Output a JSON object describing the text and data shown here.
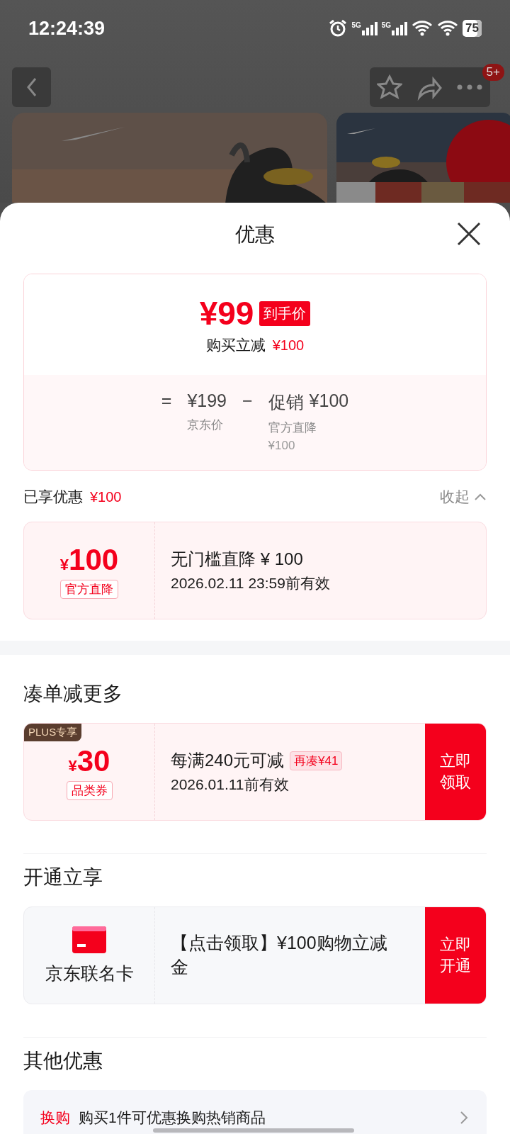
{
  "status_bar": {
    "time": "12:24:39",
    "networks": [
      "5G",
      "5G"
    ],
    "battery": "75"
  },
  "nav": {
    "badge": "5+"
  },
  "sheet": {
    "title": "优惠"
  },
  "price_card": {
    "final_price": "¥99",
    "price_tag": "到手价",
    "saving_label": "购买立减",
    "saving_amount": "¥100",
    "equals": "=",
    "list_price": "¥199",
    "list_price_label": "京东价",
    "minus": "−",
    "promo_label": "促销",
    "promo_amount": "¥100",
    "promo_sub": "官方直降",
    "promo_sub_amount": "¥100"
  },
  "enjoyed": {
    "label": "已享优惠",
    "amount": "¥100",
    "toggle": "收起",
    "expanded": true
  },
  "applied_coupons": [
    {
      "kind": "coupon",
      "currency": "¥",
      "amount": "100",
      "tag": "官方直降",
      "title": "无门槛直降 ¥ 100",
      "validity": "2026.02.11 23:59前有效"
    }
  ],
  "sections": [
    {
      "heading": "凑单减更多",
      "items": [
        {
          "kind": "coupon",
          "badge": "PLUS专享",
          "currency": "¥",
          "amount": "30",
          "tag": "品类券",
          "title": "每满240元可减",
          "extra": "再凑¥41",
          "validity": "2026.01.11前有效",
          "action": "立即领取"
        }
      ]
    },
    {
      "heading": "开通立享",
      "items": [
        {
          "kind": "card_offer",
          "name": "京东联名卡",
          "title": "【点击领取】¥100购物立减金",
          "action": "立即开通"
        }
      ]
    },
    {
      "heading": "其他优惠",
      "items": [
        {
          "kind": "link",
          "label": "换购",
          "text": "购买1件可优惠换购热销商品"
        }
      ]
    }
  ]
}
